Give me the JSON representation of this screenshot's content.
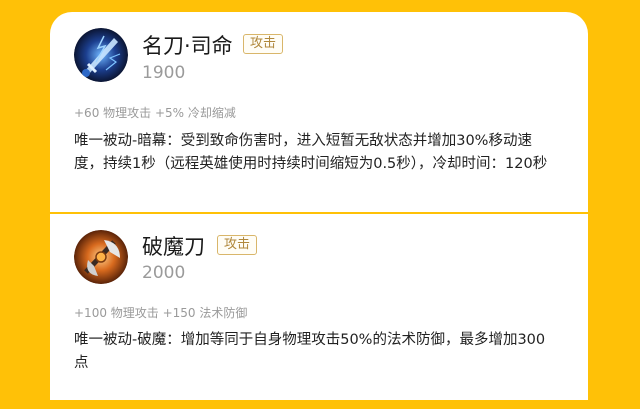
{
  "items": [
    {
      "name": "名刀·司命",
      "tag": "攻击",
      "price": "1900",
      "stats": "+60 物理攻击 +5% 冷却缩减",
      "description": "唯一被动-暗幕：受到致命伤害时，进入短暂无敌状态并增加30%移动速度，持续1秒（远程英雄使用时持续时间缩短为0.5秒），冷却时间：120秒",
      "icon": "blue-sword-icon"
    },
    {
      "name": "破魔刀",
      "tag": "攻击",
      "price": "2000",
      "stats": "+100 物理攻击 +150 法术防御",
      "description": "唯一被动-破魔：增加等同于自身物理攻击50%的法术防御，最多增加300点",
      "icon": "orange-axe-icon"
    }
  ],
  "colors": {
    "background": "#ffc107",
    "card": "#ffffff",
    "tag_text": "#b0883c",
    "tag_border": "#d9b66a",
    "muted_text": "#9a9a9a"
  }
}
